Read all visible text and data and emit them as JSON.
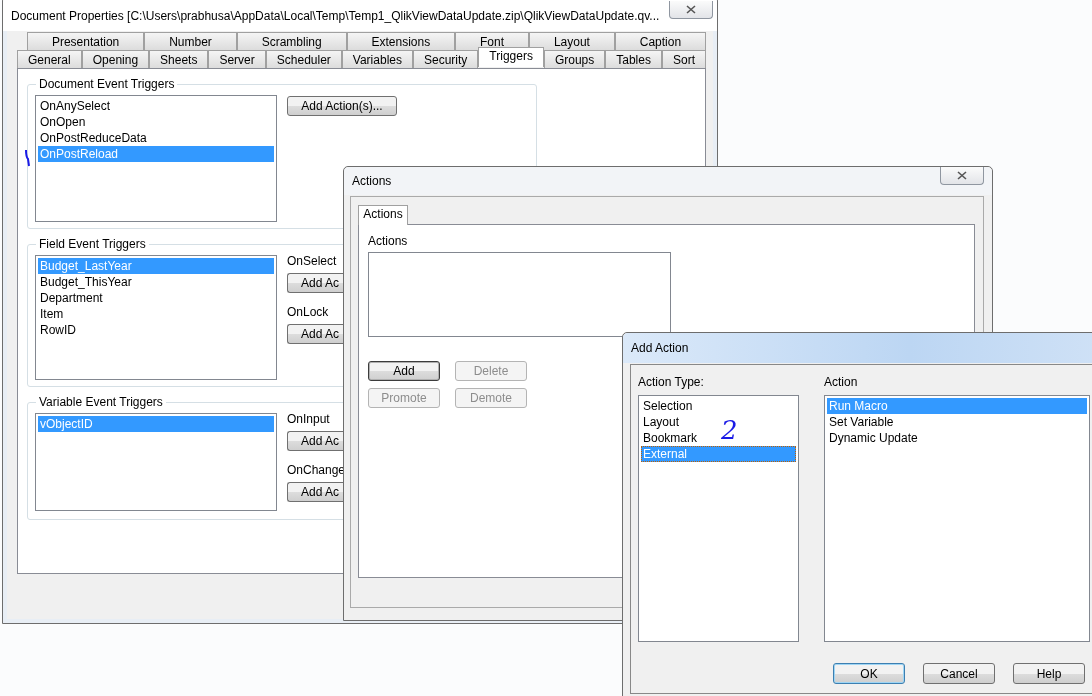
{
  "main_window": {
    "title": "Document Properties [C:\\Users\\prabhusa\\AppData\\Local\\Temp\\Temp1_QlikViewDataUpdate.zip\\QlikViewDataUpdate.qv...",
    "tab_rows": [
      [
        {
          "label": "Presentation",
          "selected": false
        },
        {
          "label": "Number",
          "selected": false
        },
        {
          "label": "Scrambling",
          "selected": false
        },
        {
          "label": "Extensions",
          "selected": false
        },
        {
          "label": "Font",
          "selected": false
        },
        {
          "label": "Layout",
          "selected": false
        },
        {
          "label": "Caption",
          "selected": false
        }
      ],
      [
        {
          "label": "General",
          "selected": false
        },
        {
          "label": "Opening",
          "selected": false
        },
        {
          "label": "Sheets",
          "selected": false
        },
        {
          "label": "Server",
          "selected": false
        },
        {
          "label": "Scheduler",
          "selected": false
        },
        {
          "label": "Variables",
          "selected": false
        },
        {
          "label": "Security",
          "selected": false
        },
        {
          "label": "Triggers",
          "selected": true
        },
        {
          "label": "Groups",
          "selected": false
        },
        {
          "label": "Tables",
          "selected": false
        },
        {
          "label": "Sort",
          "selected": false
        }
      ]
    ],
    "document_event_triggers": {
      "title": "Document Event Triggers",
      "items": [
        {
          "label": "OnAnySelect",
          "selected": false
        },
        {
          "label": "OnOpen",
          "selected": false
        },
        {
          "label": "OnPostReduceData",
          "selected": false
        },
        {
          "label": "OnPostReload",
          "selected": true
        }
      ],
      "button": "Add Action(s)..."
    },
    "field_event_triggers": {
      "title": "Field Event Triggers",
      "items": [
        {
          "label": "Budget_LastYear",
          "selected": true
        },
        {
          "label": "Budget_ThisYear",
          "selected": false
        },
        {
          "label": "Department",
          "selected": false
        },
        {
          "label": "Item",
          "selected": false
        },
        {
          "label": "RowID",
          "selected": false
        }
      ],
      "events": [
        {
          "label": "OnSelect",
          "button": "Add Ac"
        },
        {
          "label": "OnLock",
          "button": "Add Ac"
        }
      ]
    },
    "variable_event_triggers": {
      "title": "Variable Event Triggers",
      "items": [
        {
          "label": "vObjectID",
          "selected": true
        }
      ],
      "events": [
        {
          "label": "OnInput",
          "button": "Add Ac"
        },
        {
          "label": "OnChange",
          "button": "Add Ac"
        }
      ]
    }
  },
  "actions_window": {
    "title": "Actions",
    "tab": {
      "label": "Actions",
      "selected": true
    },
    "list_label": "Actions",
    "buttons": [
      {
        "label": "Add",
        "disabled": false,
        "default": true
      },
      {
        "label": "Delete",
        "disabled": true,
        "default": false
      },
      {
        "label": "Promote",
        "disabled": true,
        "default": false
      },
      {
        "label": "Demote",
        "disabled": true,
        "default": false
      }
    ]
  },
  "add_action_window": {
    "title": "Add Action",
    "annotation": "2",
    "action_type": {
      "label": "Action Type:",
      "items": [
        {
          "label": "Selection",
          "selected": false
        },
        {
          "label": "Layout",
          "selected": false
        },
        {
          "label": "Bookmark",
          "selected": false
        },
        {
          "label": "External",
          "selected": true
        }
      ]
    },
    "action": {
      "label": "Action",
      "items": [
        {
          "label": "Run Macro",
          "selected": true
        },
        {
          "label": "Set Variable",
          "selected": false
        },
        {
          "label": "Dynamic Update",
          "selected": false
        }
      ]
    },
    "buttons": [
      {
        "label": "OK",
        "disabled": false,
        "default": true
      },
      {
        "label": "Cancel",
        "disabled": false,
        "default": false
      },
      {
        "label": "Help",
        "disabled": false,
        "default": false
      }
    ]
  }
}
